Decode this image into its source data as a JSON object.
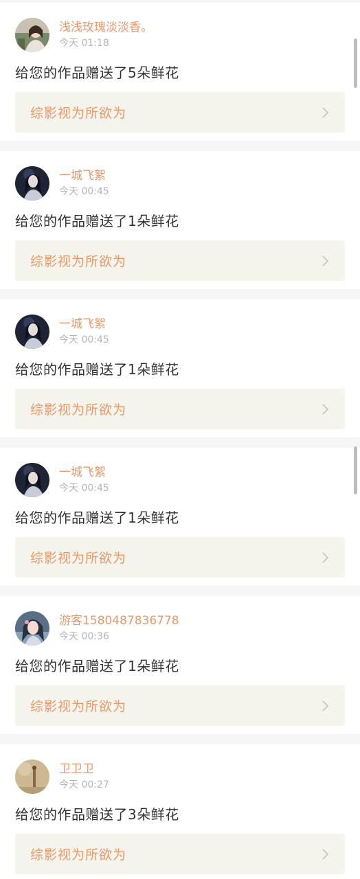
{
  "notifications": [
    {
      "username": "浅浅玫瑰淡淡香。",
      "time": "今天 01:18",
      "message": "给您的作品赠送了5朵鲜花",
      "work_title": "综影视为所欲为",
      "avatar_icon": "avatar-girl-portrait"
    },
    {
      "username": "一城飞絮",
      "time": "今天 00:45",
      "message": "给您的作品赠送了1朵鲜花",
      "work_title": "综影视为所欲为",
      "avatar_icon": "avatar-man-dark-portrait"
    },
    {
      "username": "一城飞絮",
      "time": "今天 00:45",
      "message": "给您的作品赠送了1朵鲜花",
      "work_title": "综影视为所欲为",
      "avatar_icon": "avatar-man-dark-portrait"
    },
    {
      "username": "一城飞絮",
      "time": "今天 00:45",
      "message": "给您的作品赠送了1朵鲜花",
      "work_title": "综影视为所欲为",
      "avatar_icon": "avatar-man-dark-portrait"
    },
    {
      "username": "游客1580487836778",
      "time": "今天 00:36",
      "message": "给您的作品赠送了1朵鲜花",
      "work_title": "综影视为所欲为",
      "avatar_icon": "avatar-anime-girl-portrait"
    },
    {
      "username": "卫卫卫",
      "time": "今天 00:27",
      "message": "给您的作品赠送了3朵鲜花",
      "work_title": "综影视为所欲为",
      "avatar_icon": "avatar-sepia-portrait"
    }
  ],
  "colors": {
    "accent": "#e8996a",
    "link_bg": "#f4f3ec",
    "timestamp": "#b5b5b5",
    "text": "#333333"
  }
}
